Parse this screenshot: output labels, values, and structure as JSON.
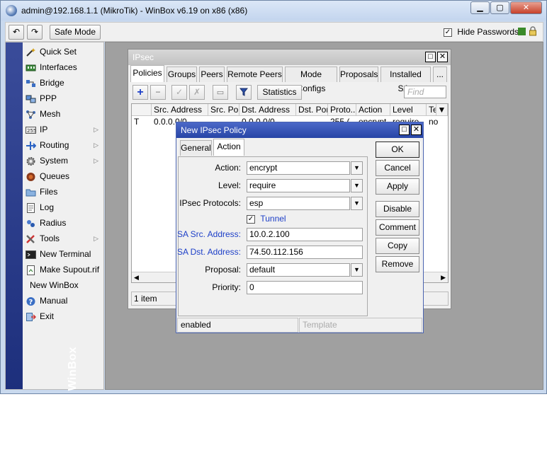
{
  "window": {
    "title": "admin@192.168.1.1 (MikroTik) - WinBox v6.19 on x86 (x86)"
  },
  "toolbar": {
    "undo_icon": "↶",
    "redo_icon": "↷",
    "safe_mode_label": "Safe Mode",
    "hide_passwords_label": "Hide Passwords",
    "hide_passwords_checked": "✓"
  },
  "sidebar": {
    "brand": "RouterOS WinBox",
    "items": [
      {
        "label": "Quick Set"
      },
      {
        "label": "Interfaces"
      },
      {
        "label": "Bridge"
      },
      {
        "label": "PPP"
      },
      {
        "label": "Mesh"
      },
      {
        "label": "IP"
      },
      {
        "label": "Routing"
      },
      {
        "label": "System"
      },
      {
        "label": "Queues"
      },
      {
        "label": "Files"
      },
      {
        "label": "Log"
      },
      {
        "label": "Radius"
      },
      {
        "label": "Tools"
      },
      {
        "label": "New Terminal"
      },
      {
        "label": "Make Supout.rif"
      },
      {
        "label": "New WinBox"
      },
      {
        "label": "Manual"
      },
      {
        "label": "Exit"
      }
    ]
  },
  "ipsec": {
    "title": "IPsec",
    "tabs": [
      "Policies",
      "Groups",
      "Peers",
      "Remote Peers",
      "Mode Configs",
      "Proposals",
      "Installed SAs",
      "..."
    ],
    "statistics_label": "Statistics",
    "find_placeholder": "Find",
    "columns": [
      "Src. Address",
      "Src. Port",
      "Dst. Address",
      "Dst. Port",
      "Proto...",
      "Action",
      "Level",
      "Te"
    ],
    "row": {
      "flag": "T",
      "src": "0.0.0.0/0",
      "dst": "0.0.0.0/0",
      "proto": "255 (...",
      "action": "encrypt",
      "level": "require",
      "te": "no"
    },
    "footer": "1 item"
  },
  "dialog": {
    "title": "New IPsec Policy",
    "tabs": [
      "General",
      "Action"
    ],
    "fields": {
      "action_label": "Action:",
      "action_value": "encrypt",
      "level_label": "Level:",
      "level_value": "require",
      "protocols_label": "IPsec Protocols:",
      "protocols_value": "esp",
      "tunnel_label": "Tunnel",
      "tunnel_checked": "✓",
      "sa_src_label": "SA Src. Address:",
      "sa_src_value": "10.0.2.100",
      "sa_dst_label": "SA Dst. Address:",
      "sa_dst_value": "74.50.112.156",
      "proposal_label": "Proposal:",
      "proposal_value": "default",
      "priority_label": "Priority:",
      "priority_value": "0"
    },
    "buttons": [
      "OK",
      "Cancel",
      "Apply",
      "Disable",
      "Comment",
      "Copy",
      "Remove"
    ],
    "status_left": "enabled",
    "status_right": "Template"
  },
  "colors": {
    "accent": "#2745a6",
    "sidebar_strip": "#1d2f7c"
  }
}
